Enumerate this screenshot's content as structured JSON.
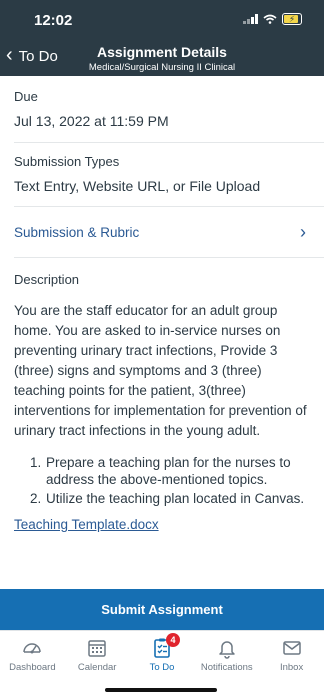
{
  "status_bar": {
    "time": "12:02"
  },
  "header": {
    "back_label": "To Do",
    "title": "Assignment Details",
    "subtitle": "Medical/Surgical Nursing II Clinical"
  },
  "due": {
    "label": "Due",
    "value": "Jul 13, 2022 at 11:59 PM"
  },
  "submission_types": {
    "label": "Submission Types",
    "value": "Text Entry, Website URL, or File Upload"
  },
  "rubric_link": {
    "label": "Submission & Rubric"
  },
  "description": {
    "label": "Description",
    "body": "You are the staff educator for an adult group home. You are asked to in-service nurses on preventing urinary tract infections, Provide 3 (three) signs and symptoms and 3 (three) teaching points for the patient, 3(three) interventions for implementation for prevention of urinary tract infections in the young adult.",
    "list": [
      {
        "num": "1.",
        "text": "Prepare a teaching plan for the nurses to address the above-mentioned topics."
      },
      {
        "num": "2.",
        "text": "Utilize the teaching plan located in Canvas."
      }
    ],
    "attachment": "Teaching Template.docx"
  },
  "submit_button": "Submit Assignment",
  "tabbar": {
    "items": [
      {
        "label": "Dashboard",
        "icon": "dashboard-icon"
      },
      {
        "label": "Calendar",
        "icon": "calendar-icon"
      },
      {
        "label": "To Do",
        "icon": "todo-icon",
        "badge": "4"
      },
      {
        "label": "Notifications",
        "icon": "bell-icon"
      },
      {
        "label": "Inbox",
        "icon": "inbox-icon"
      }
    ]
  },
  "colors": {
    "header_bg": "#2b3b45",
    "accent": "#166fb3",
    "link": "#2b5a94",
    "badge": "#e0242d"
  }
}
